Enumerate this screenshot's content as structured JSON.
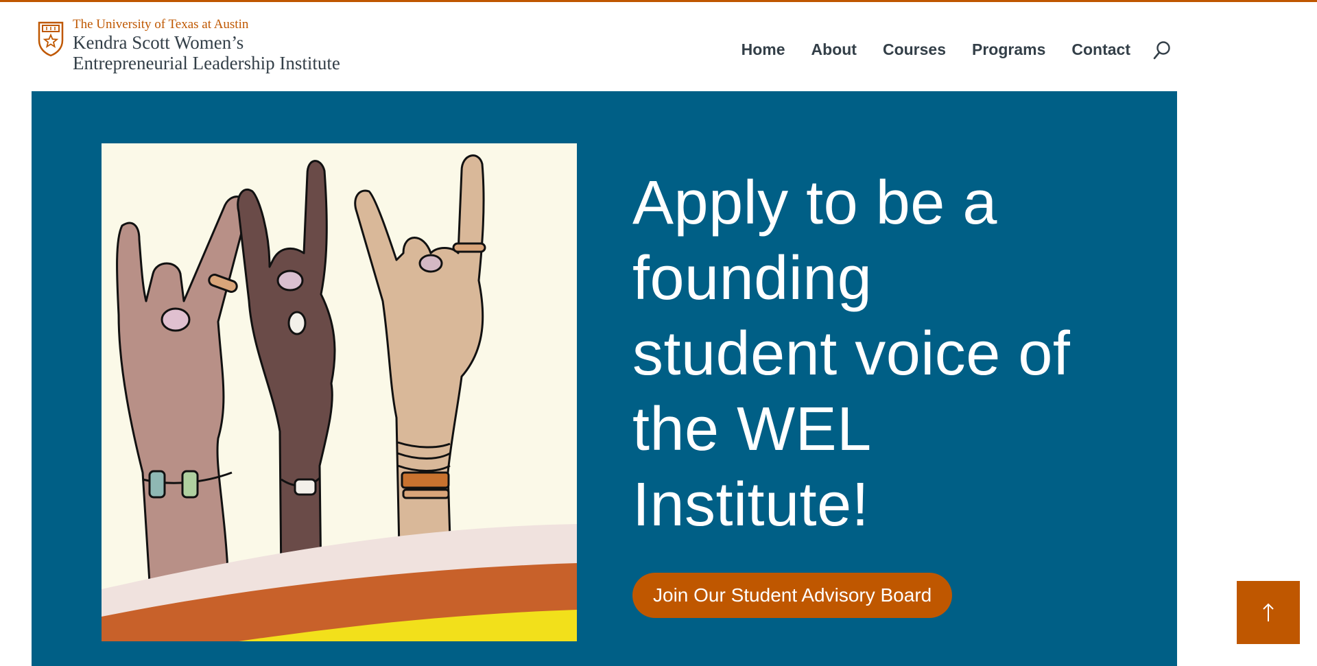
{
  "brand": {
    "university": "The University of Texas at Austin",
    "name_line1": "Kendra Scott Women’s",
    "name_line2": "Entrepreneurial Leadership Institute",
    "accent_color": "#bf5700",
    "text_color": "#333f48"
  },
  "nav": {
    "items": [
      {
        "label": "Home"
      },
      {
        "label": "About"
      },
      {
        "label": "Courses"
      },
      {
        "label": "Programs"
      },
      {
        "label": "Contact"
      }
    ],
    "search_icon": "search-icon"
  },
  "hero": {
    "background": "#005f86",
    "headline_lines": [
      "Apply to be a",
      "founding",
      "student voice of",
      "the WEL",
      "Institute!"
    ],
    "cta_label": "Join Our Student Advisory Board",
    "illustration": "three-hands-horns-illustration"
  },
  "scroll_top": {
    "icon": "arrow-up-icon"
  }
}
